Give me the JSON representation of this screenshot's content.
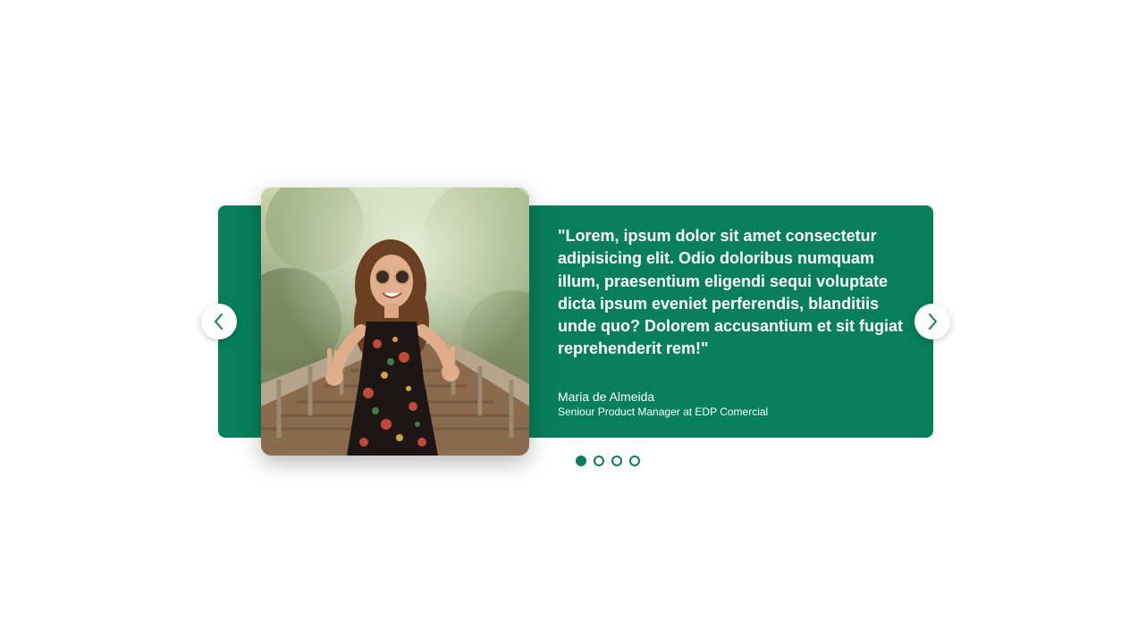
{
  "testimonial": {
    "quote": "\"Lorem, ipsum dolor sit amet consectetur adipisicing elit. Odio doloribus numquam illum, praesentium eligendi sequi voluptate dicta ipsum eveniet perferendis, blanditiis unde quo? Dolorem accusantium et sit fugiat reprehenderit rem!\"",
    "author_name": "Maria de Almeida",
    "author_role": "Seniour Product Manager at EDP Comercial",
    "photo_icon": "person-photo"
  },
  "navigation": {
    "prev_icon": "chevron-left-icon",
    "next_icon": "chevron-right-icon"
  },
  "pagination": {
    "total": 4,
    "active_index": 0
  },
  "colors": {
    "accent": "#077f5a",
    "text_on_accent": "#ffffff",
    "background": "#ffffff"
  }
}
